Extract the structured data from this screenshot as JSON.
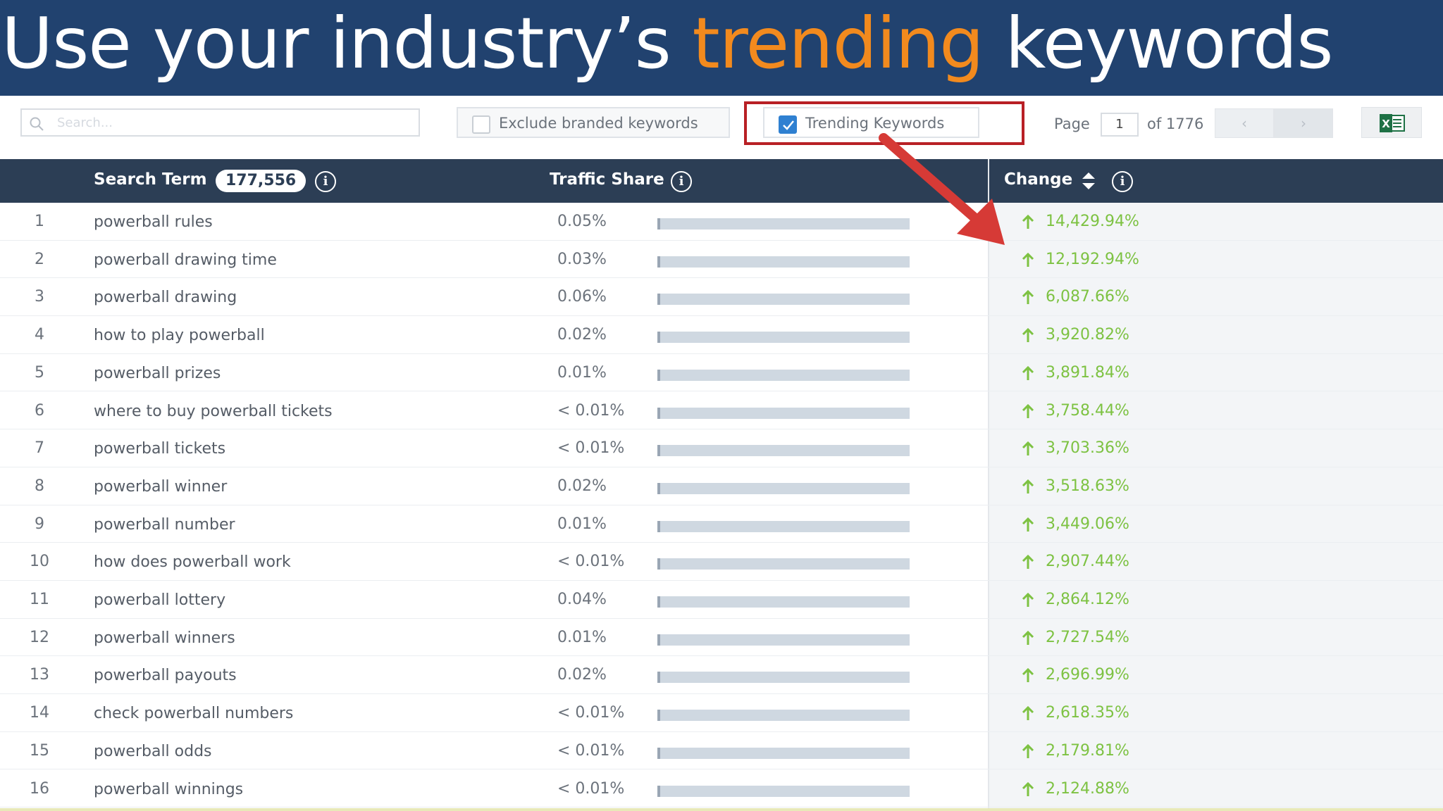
{
  "title": {
    "before": "Use your industry’s ",
    "highlight": "trending",
    "after": " keywords"
  },
  "toolbar": {
    "search_placeholder": "Search...",
    "exclude_label": "Exclude branded keywords",
    "exclude_checked": false,
    "trending_label": "Trending Keywords",
    "trending_checked": true,
    "page_label": "Page",
    "page_value": "1",
    "page_of": "of 1776",
    "prev_icon": "chevron-left-icon",
    "next_icon": "chevron-right-icon",
    "export_icon": "excel-icon"
  },
  "table": {
    "headers": {
      "term": "Search Term",
      "count": "177,556",
      "share": "Traffic Share",
      "change": "Change"
    },
    "rows": [
      {
        "num": "1",
        "term": "powerball rules",
        "share": "0.05%",
        "change": "14,429.94%"
      },
      {
        "num": "2",
        "term": "powerball drawing time",
        "share": "0.03%",
        "change": "12,192.94%"
      },
      {
        "num": "3",
        "term": "powerball drawing",
        "share": "0.06%",
        "change": "6,087.66%"
      },
      {
        "num": "4",
        "term": "how to play powerball",
        "share": "0.02%",
        "change": "3,920.82%"
      },
      {
        "num": "5",
        "term": "powerball prizes",
        "share": "0.01%",
        "change": "3,891.84%"
      },
      {
        "num": "6",
        "term": "where to buy powerball tickets",
        "share": "< 0.01%",
        "change": "3,758.44%"
      },
      {
        "num": "7",
        "term": "powerball tickets",
        "share": "< 0.01%",
        "change": "3,703.36%"
      },
      {
        "num": "8",
        "term": "powerball winner",
        "share": "0.02%",
        "change": "3,518.63%"
      },
      {
        "num": "9",
        "term": "powerball number",
        "share": "0.01%",
        "change": "3,449.06%"
      },
      {
        "num": "10",
        "term": "how does powerball work",
        "share": "< 0.01%",
        "change": "2,907.44%"
      },
      {
        "num": "11",
        "term": "powerball lottery",
        "share": "0.04%",
        "change": "2,864.12%"
      },
      {
        "num": "12",
        "term": "powerball winners",
        "share": "0.01%",
        "change": "2,727.54%"
      },
      {
        "num": "13",
        "term": "powerball payouts",
        "share": "0.02%",
        "change": "2,696.99%"
      },
      {
        "num": "14",
        "term": "check powerball numbers",
        "share": "< 0.01%",
        "change": "2,618.35%"
      },
      {
        "num": "15",
        "term": "powerball odds",
        "share": "< 0.01%",
        "change": "2,179.81%"
      },
      {
        "num": "16",
        "term": "powerball winnings",
        "share": "< 0.01%",
        "change": "2,124.88%"
      }
    ]
  },
  "colors": {
    "banner": "#21426f",
    "highlight_text": "#f28a1e",
    "header": "#2c3e55",
    "change_green": "#7dc242",
    "annotation_red": "#d63a36"
  }
}
